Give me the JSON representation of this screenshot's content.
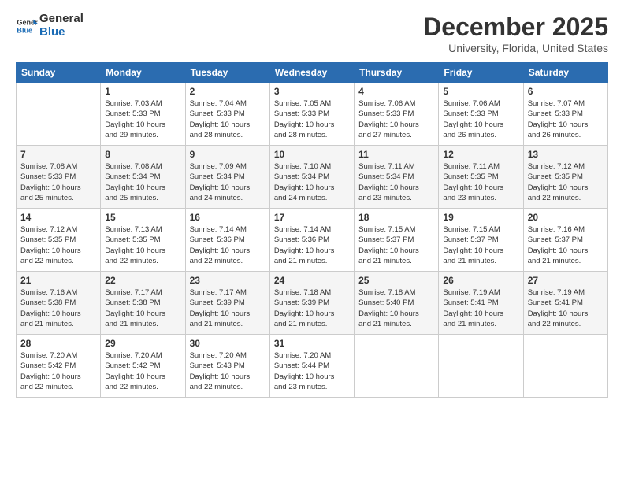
{
  "logo": {
    "text_general": "General",
    "text_blue": "Blue"
  },
  "header": {
    "month_year": "December 2025",
    "location": "University, Florida, United States"
  },
  "weekdays": [
    "Sunday",
    "Monday",
    "Tuesday",
    "Wednesday",
    "Thursday",
    "Friday",
    "Saturday"
  ],
  "weeks": [
    [
      {
        "day": "",
        "info": ""
      },
      {
        "day": "1",
        "info": "Sunrise: 7:03 AM\nSunset: 5:33 PM\nDaylight: 10 hours\nand 29 minutes."
      },
      {
        "day": "2",
        "info": "Sunrise: 7:04 AM\nSunset: 5:33 PM\nDaylight: 10 hours\nand 28 minutes."
      },
      {
        "day": "3",
        "info": "Sunrise: 7:05 AM\nSunset: 5:33 PM\nDaylight: 10 hours\nand 28 minutes."
      },
      {
        "day": "4",
        "info": "Sunrise: 7:06 AM\nSunset: 5:33 PM\nDaylight: 10 hours\nand 27 minutes."
      },
      {
        "day": "5",
        "info": "Sunrise: 7:06 AM\nSunset: 5:33 PM\nDaylight: 10 hours\nand 26 minutes."
      },
      {
        "day": "6",
        "info": "Sunrise: 7:07 AM\nSunset: 5:33 PM\nDaylight: 10 hours\nand 26 minutes."
      }
    ],
    [
      {
        "day": "7",
        "info": "Sunrise: 7:08 AM\nSunset: 5:33 PM\nDaylight: 10 hours\nand 25 minutes."
      },
      {
        "day": "8",
        "info": "Sunrise: 7:08 AM\nSunset: 5:34 PM\nDaylight: 10 hours\nand 25 minutes."
      },
      {
        "day": "9",
        "info": "Sunrise: 7:09 AM\nSunset: 5:34 PM\nDaylight: 10 hours\nand 24 minutes."
      },
      {
        "day": "10",
        "info": "Sunrise: 7:10 AM\nSunset: 5:34 PM\nDaylight: 10 hours\nand 24 minutes."
      },
      {
        "day": "11",
        "info": "Sunrise: 7:11 AM\nSunset: 5:34 PM\nDaylight: 10 hours\nand 23 minutes."
      },
      {
        "day": "12",
        "info": "Sunrise: 7:11 AM\nSunset: 5:35 PM\nDaylight: 10 hours\nand 23 minutes."
      },
      {
        "day": "13",
        "info": "Sunrise: 7:12 AM\nSunset: 5:35 PM\nDaylight: 10 hours\nand 22 minutes."
      }
    ],
    [
      {
        "day": "14",
        "info": "Sunrise: 7:12 AM\nSunset: 5:35 PM\nDaylight: 10 hours\nand 22 minutes."
      },
      {
        "day": "15",
        "info": "Sunrise: 7:13 AM\nSunset: 5:35 PM\nDaylight: 10 hours\nand 22 minutes."
      },
      {
        "day": "16",
        "info": "Sunrise: 7:14 AM\nSunset: 5:36 PM\nDaylight: 10 hours\nand 22 minutes."
      },
      {
        "day": "17",
        "info": "Sunrise: 7:14 AM\nSunset: 5:36 PM\nDaylight: 10 hours\nand 21 minutes."
      },
      {
        "day": "18",
        "info": "Sunrise: 7:15 AM\nSunset: 5:37 PM\nDaylight: 10 hours\nand 21 minutes."
      },
      {
        "day": "19",
        "info": "Sunrise: 7:15 AM\nSunset: 5:37 PM\nDaylight: 10 hours\nand 21 minutes."
      },
      {
        "day": "20",
        "info": "Sunrise: 7:16 AM\nSunset: 5:37 PM\nDaylight: 10 hours\nand 21 minutes."
      }
    ],
    [
      {
        "day": "21",
        "info": "Sunrise: 7:16 AM\nSunset: 5:38 PM\nDaylight: 10 hours\nand 21 minutes."
      },
      {
        "day": "22",
        "info": "Sunrise: 7:17 AM\nSunset: 5:38 PM\nDaylight: 10 hours\nand 21 minutes."
      },
      {
        "day": "23",
        "info": "Sunrise: 7:17 AM\nSunset: 5:39 PM\nDaylight: 10 hours\nand 21 minutes."
      },
      {
        "day": "24",
        "info": "Sunrise: 7:18 AM\nSunset: 5:39 PM\nDaylight: 10 hours\nand 21 minutes."
      },
      {
        "day": "25",
        "info": "Sunrise: 7:18 AM\nSunset: 5:40 PM\nDaylight: 10 hours\nand 21 minutes."
      },
      {
        "day": "26",
        "info": "Sunrise: 7:19 AM\nSunset: 5:41 PM\nDaylight: 10 hours\nand 21 minutes."
      },
      {
        "day": "27",
        "info": "Sunrise: 7:19 AM\nSunset: 5:41 PM\nDaylight: 10 hours\nand 22 minutes."
      }
    ],
    [
      {
        "day": "28",
        "info": "Sunrise: 7:20 AM\nSunset: 5:42 PM\nDaylight: 10 hours\nand 22 minutes."
      },
      {
        "day": "29",
        "info": "Sunrise: 7:20 AM\nSunset: 5:42 PM\nDaylight: 10 hours\nand 22 minutes."
      },
      {
        "day": "30",
        "info": "Sunrise: 7:20 AM\nSunset: 5:43 PM\nDaylight: 10 hours\nand 22 minutes."
      },
      {
        "day": "31",
        "info": "Sunrise: 7:20 AM\nSunset: 5:44 PM\nDaylight: 10 hours\nand 23 minutes."
      },
      {
        "day": "",
        "info": ""
      },
      {
        "day": "",
        "info": ""
      },
      {
        "day": "",
        "info": ""
      }
    ]
  ]
}
